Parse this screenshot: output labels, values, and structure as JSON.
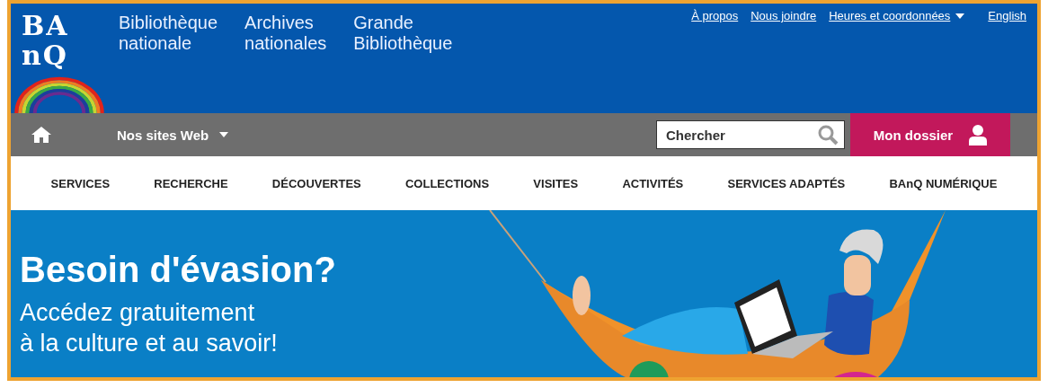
{
  "header": {
    "logo_lines": [
      "BA",
      "nQ"
    ],
    "sites": [
      {
        "line1": "Bibliothèque",
        "line2": "nationale"
      },
      {
        "line1": "Archives",
        "line2": "nationales"
      },
      {
        "line1": "Grande",
        "line2": "Bibliothèque"
      }
    ],
    "utility_links": [
      {
        "label": "À propos",
        "has_dropdown": false
      },
      {
        "label": "Nous joindre",
        "has_dropdown": false
      },
      {
        "label": "Heures et coordonnées",
        "has_dropdown": true
      },
      {
        "label": "English",
        "has_dropdown": false
      }
    ]
  },
  "toolbar": {
    "sites_menu": "Nos sites Web",
    "search": {
      "placeholder": "Chercher"
    },
    "account_button": "Mon dossier"
  },
  "nav": [
    "SERVICES",
    "RECHERCHE",
    "DÉCOUVERTES",
    "COLLECTIONS",
    "VISITES",
    "ACTIVITÉS",
    "SERVICES ADAPTÉS",
    "BAnQ NUMÉRIQUE"
  ],
  "hero": {
    "title": "Besoin d'évasion?",
    "subtitle_lines": [
      "Accédez gratuitement",
      "à la culture et au savoir!"
    ]
  }
}
